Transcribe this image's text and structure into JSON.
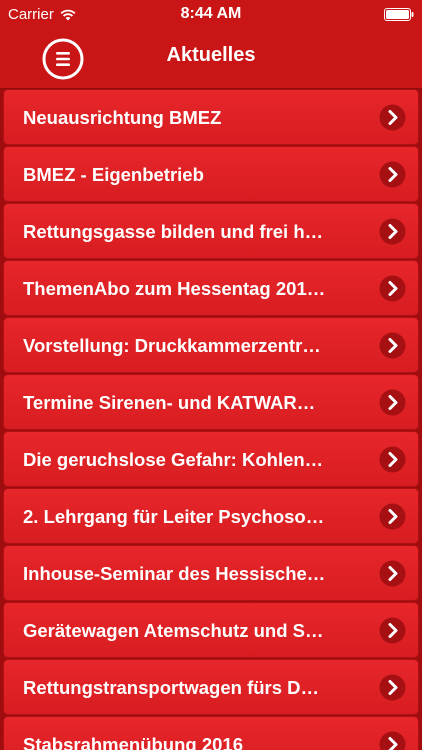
{
  "status_bar": {
    "carrier": "Carrier",
    "time": "8:44 AM"
  },
  "nav": {
    "title": "Aktuelles",
    "menu_icon": "menu-icon"
  },
  "colors": {
    "accent": "#c91515",
    "row": "#e32428",
    "text": "#ffffff"
  },
  "list": {
    "items": [
      {
        "label": "Neuausrichtung BMEZ"
      },
      {
        "label": "BMEZ - Eigenbetrieb"
      },
      {
        "label": "Rettungsgasse bilden und frei h…"
      },
      {
        "label": "ThemenAbo zum Hessentag 201…"
      },
      {
        "label": "Vorstellung: Druckkammerzentr…"
      },
      {
        "label": "Termine Sirenen- und KATWAR…"
      },
      {
        "label": "Die geruchslose Gefahr: Kohlen…"
      },
      {
        "label": "2. Lehrgang für Leiter Psychoso…"
      },
      {
        "label": "Inhouse-Seminar des Hessische…"
      },
      {
        "label": "Gerätewagen Atemschutz und S…"
      },
      {
        "label": "Rettungstransportwagen fürs D…"
      },
      {
        "label": "Stabsrahmenübung 2016"
      }
    ]
  }
}
